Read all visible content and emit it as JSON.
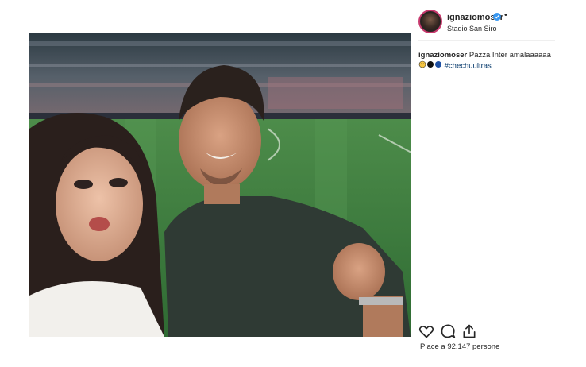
{
  "post": {
    "username": "ignaziomoser",
    "header_dot": "•",
    "location": "Stadio San Siro",
    "caption_user": "ignaziomoser",
    "caption_text": "Pazza Inter amalaaaaaa",
    "hashtag": "#chechuultras",
    "likes_text": "Piace a 92.147 persone"
  },
  "icons": {
    "verified": "verified-badge-icon",
    "like": "heart-icon",
    "comment": "comment-bubble-icon",
    "share": "share-icon"
  },
  "colors": {
    "verified_blue": "#3897f0",
    "hashtag": "#003569",
    "story_ring": "#c7396d"
  }
}
